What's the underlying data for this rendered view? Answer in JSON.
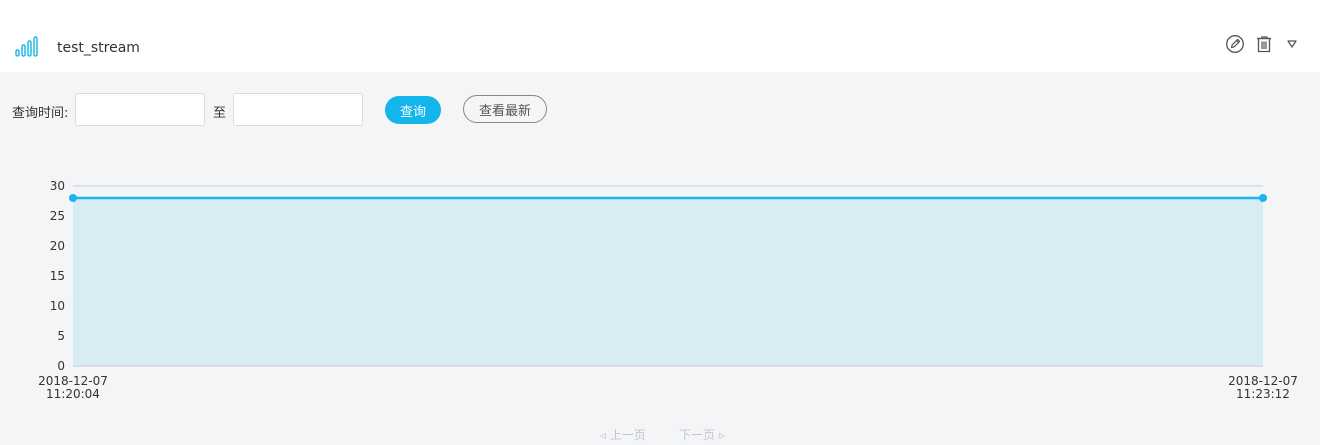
{
  "header": {
    "title": "test_stream",
    "stream_icon": "bar-chart-icon",
    "edit_icon": "edit-icon",
    "delete_icon": "trash-icon",
    "menu_icon": "caret-down-icon"
  },
  "filter": {
    "label": "查询时间:",
    "start_value": "",
    "separator": "至",
    "end_value": "",
    "query_button": "查询",
    "latest_button": "查看最新"
  },
  "colors": {
    "accent": "#13b5ea",
    "line": "#1ab4f0",
    "area": "#d8ecf3"
  },
  "chart_data": {
    "type": "area",
    "x": [
      "2018-12-07 11:20:04",
      "2018-12-07 11:23:12"
    ],
    "x_ticks": [
      {
        "date": "2018-12-07",
        "time": "11:20:04"
      },
      {
        "date": "2018-12-07",
        "time": "11:23:12"
      }
    ],
    "series": [
      {
        "values": [
          28,
          28
        ]
      }
    ],
    "yticks": [
      0,
      5,
      10,
      15,
      20,
      25,
      30
    ],
    "ylim": [
      0,
      30
    ],
    "grid": true,
    "title": "",
    "xlabel": "",
    "ylabel": ""
  },
  "pager": {
    "prev": "上一页",
    "next": "下一页"
  }
}
